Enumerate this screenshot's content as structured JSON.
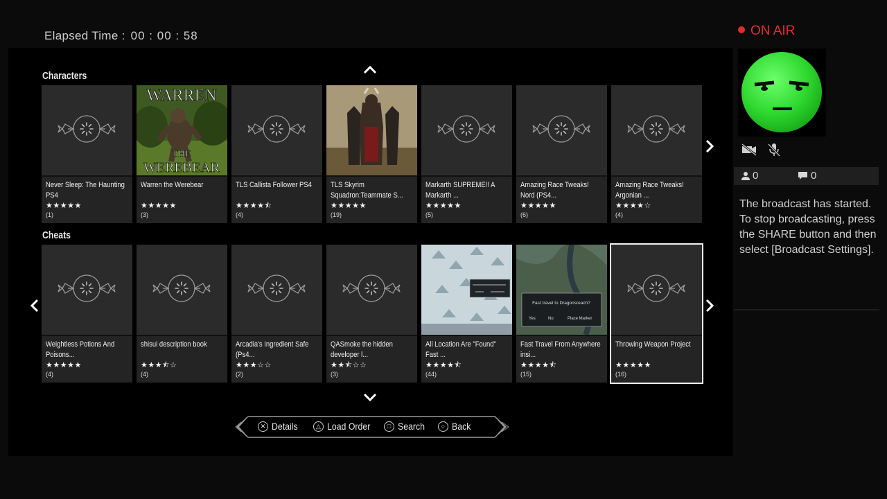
{
  "header": {
    "elapsed_label": "Elapsed Time :",
    "elapsed_value": "00 : 00 : 58"
  },
  "sections": [
    {
      "title": "Characters",
      "cards": [
        {
          "title": "Never Sleep: The Haunting PS4",
          "stars": "★★★★★",
          "count": "(1)",
          "thumb": "placeholder"
        },
        {
          "title": "Warren the Werebear",
          "stars": "★★★★★",
          "count": "(3)",
          "thumb": "werebear",
          "thumb_text_top": "WARREN",
          "thumb_text_mid": "THE",
          "thumb_text_bot": "WEREBEAR"
        },
        {
          "title": "TLS Callista Follower PS4",
          "stars": "★★★★⯪",
          "count": "(4)",
          "thumb": "placeholder"
        },
        {
          "title": "TLS Skyrim Squadron:Teammate S...",
          "stars": "★★★★★",
          "count": "(19)",
          "thumb": "squad"
        },
        {
          "title": "Markarth SUPREME!! A Markarth ...",
          "stars": "★★★★★",
          "count": "(5)",
          "thumb": "placeholder"
        },
        {
          "title": "Amazing Race Tweaks! Nord (PS4...",
          "stars": "★★★★★",
          "count": "(6)",
          "thumb": "placeholder"
        },
        {
          "title": "Amazing Race Tweaks! Argonian ...",
          "stars": "★★★★☆",
          "count": "(4)",
          "thumb": "placeholder"
        }
      ]
    },
    {
      "title": "Cheats",
      "cards": [
        {
          "title": "Weightless Potions And Poisons...",
          "stars": "★★★★★",
          "count": "(4)",
          "thumb": "placeholder"
        },
        {
          "title": "shisui description book",
          "stars": "★★★⯪☆",
          "count": "(4)",
          "thumb": "placeholder"
        },
        {
          "title": "Arcadia's Ingredient Safe (Ps4...",
          "stars": "★★★☆☆",
          "count": "(2)",
          "thumb": "placeholder"
        },
        {
          "title": "QASmoke the hidden developer l...",
          "stars": "★★⯪☆☆",
          "count": "(3)",
          "thumb": "placeholder"
        },
        {
          "title": "All Location Are \"Found\" Fast ...",
          "stars": "★★★★⯪",
          "count": "(44)",
          "thumb": "snowmap"
        },
        {
          "title": "Fast Travel From Anywhere insi...",
          "stars": "★★★★⯪",
          "count": "(15)",
          "thumb": "travelmap",
          "dialog_text": "Fast travel to Dragonsreach?",
          "dialog_yes": "Yes",
          "dialog_no": "No",
          "dialog_marker": "Place Marker"
        },
        {
          "title": "Throwing Weapon Project",
          "stars": "★★★★★",
          "count": "(16)",
          "thumb": "placeholder",
          "selected": true
        }
      ]
    }
  ],
  "nav": [
    {
      "symbol": "✕",
      "label": "Details"
    },
    {
      "symbol": "△",
      "label": "Load Order"
    },
    {
      "symbol": "□",
      "label": "Search"
    },
    {
      "symbol": "○",
      "label": "Back"
    }
  ],
  "broadcast": {
    "on_air": "ON AIR",
    "viewers": "0",
    "comments": "0",
    "message": "The broadcast has started.\nTo stop broadcasting, press the SHARE button and then select [Broadcast Settings]."
  },
  "colors": {
    "on_air": "#e62a2a",
    "avatar_green": "#3ce03c",
    "card_bg": "#242424"
  },
  "icons": {
    "camera": "camera-off-icon",
    "mic": "mic-off-icon",
    "viewers": "person-icon",
    "comments": "speech-bubble-icon"
  }
}
